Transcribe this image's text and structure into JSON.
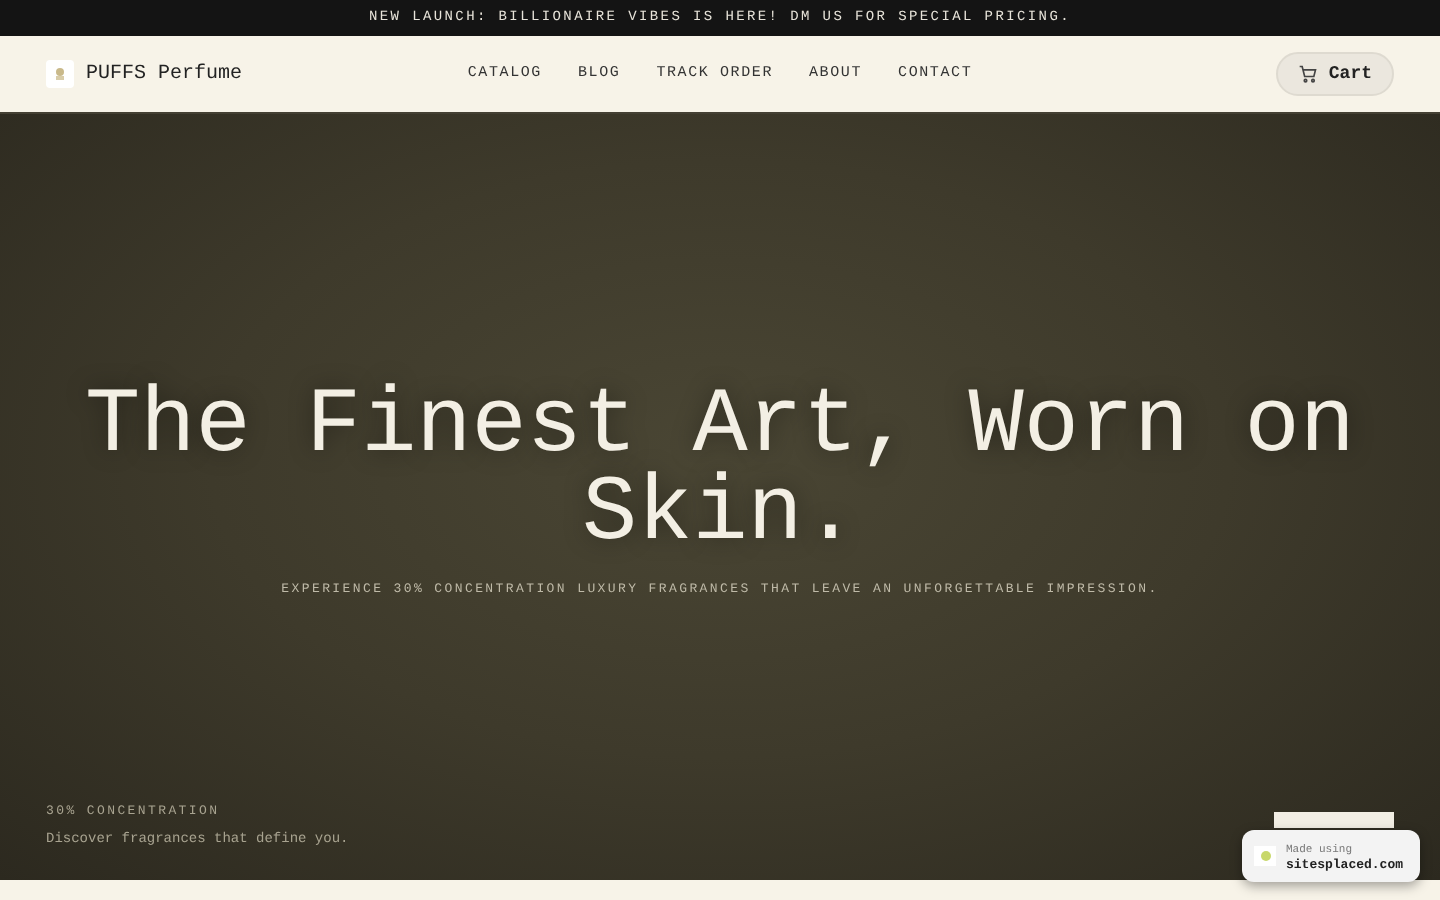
{
  "announcement": "NEW LAUNCH: BILLIONAIRE VIBES IS HERE! DM US FOR SPECIAL PRICING.",
  "header": {
    "brand": "PUFFS Perfume",
    "nav": [
      {
        "label": "CATALOG"
      },
      {
        "label": "BLOG"
      },
      {
        "label": "TRACK ORDER"
      },
      {
        "label": "ABOUT"
      },
      {
        "label": "CONTACT"
      }
    ],
    "cart": "Cart"
  },
  "hero": {
    "title": "The Finest Art, Worn on Skin.",
    "subtitle": "EXPERIENCE 30% CONCENTRATION LUXURY FRAGRANCES THAT LEAVE AN UNFORGETTABLE IMPRESSION.",
    "eyebrow": "30% CONCENTRATION",
    "tagline": "Discover fragrances that define you."
  },
  "badge": {
    "line1": "Made using",
    "line2": "sitesplaced.com"
  }
}
